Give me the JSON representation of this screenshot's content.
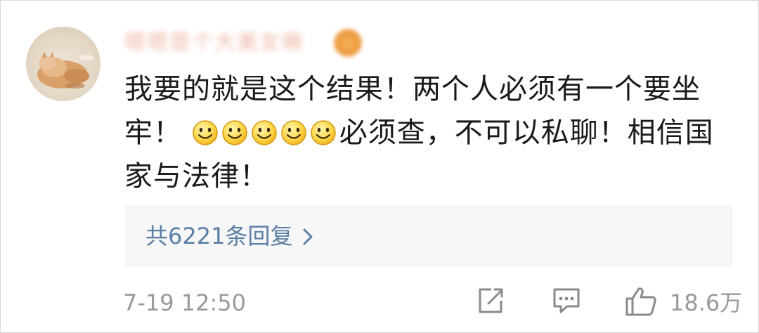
{
  "comment": {
    "username": "嗯嗯是个大美女嘛",
    "text_part1": "我要的就是这个结果！两个人必须有一个要坐牢！",
    "emoji_count": 5,
    "text_part2": "必须查，不可以私聊！相信国家与法律！",
    "replies_label": "共6221条回复",
    "timestamp": "7-19 12:50",
    "like_count": "18.6万"
  },
  "icons": {
    "avatar": "cat-avatar",
    "badge": "user-badge-icon",
    "emoji": "smile-emoji",
    "reply_chevron": "chevron-right-icon",
    "share": "share-icon",
    "comment": "comment-icon",
    "like": "thumbs-up-icon"
  },
  "colors": {
    "link": "#5b7fa6",
    "meta": "#9a9a9a",
    "text": "#1a1a1a",
    "reply_bg": "#f7f7f7"
  }
}
